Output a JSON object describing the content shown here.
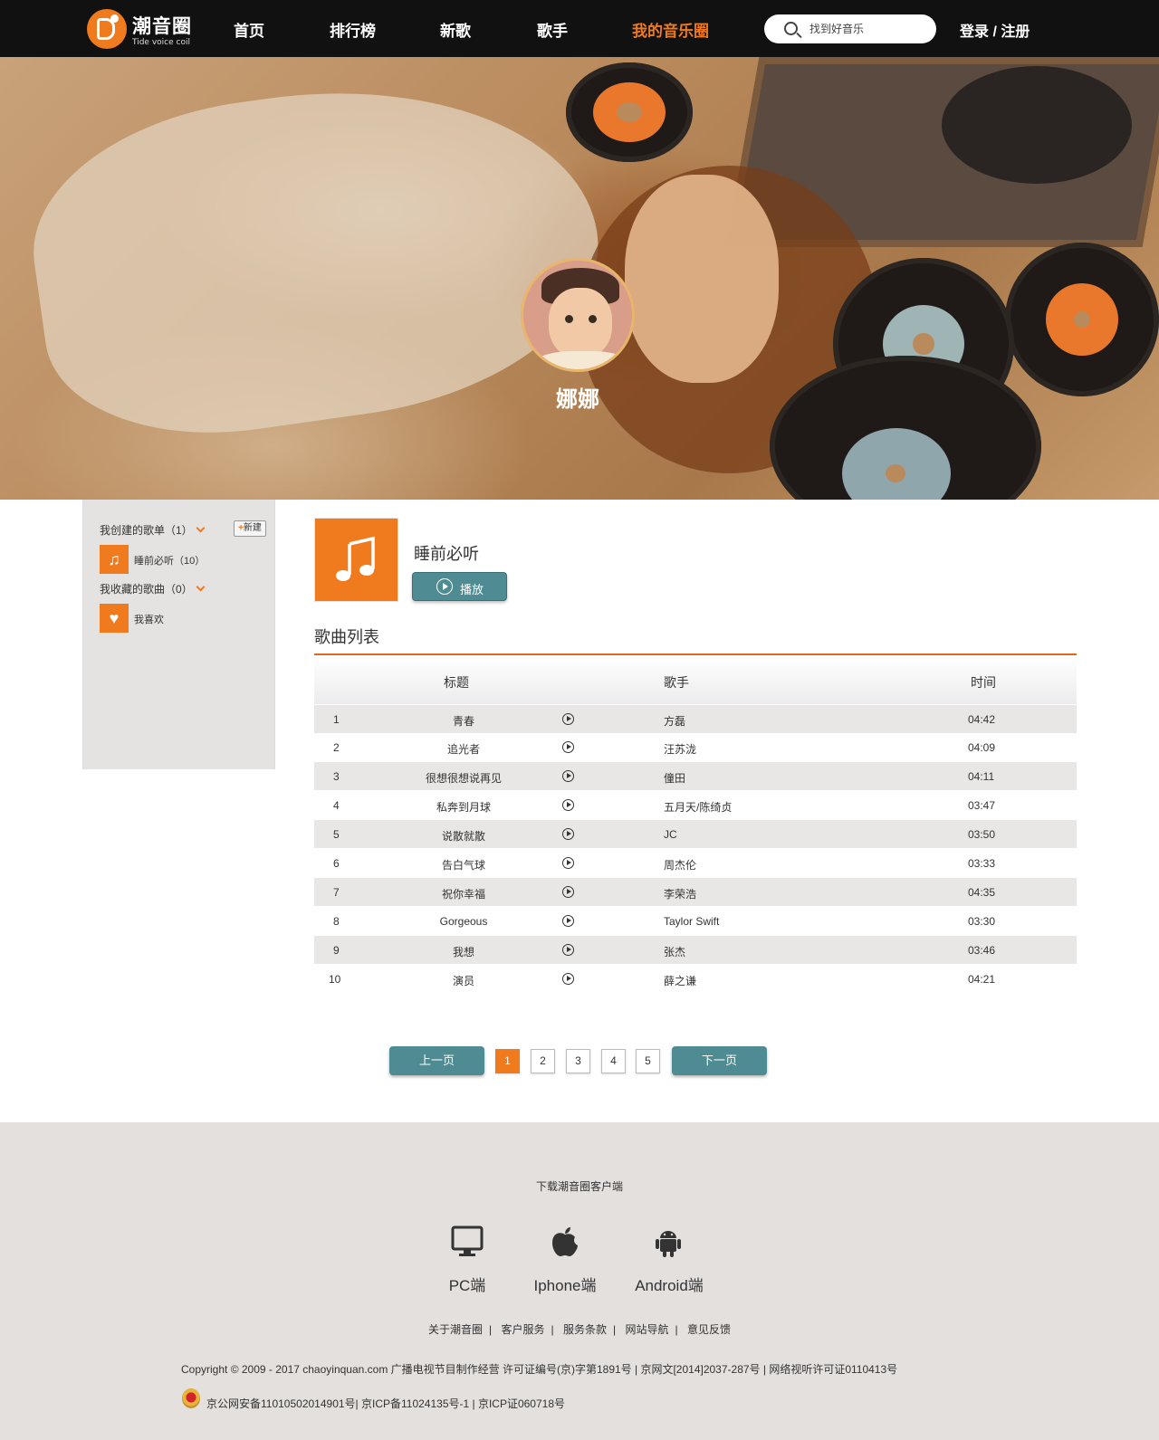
{
  "header": {
    "logo_text": "潮音圈",
    "logo_sub": "Tide voice coil",
    "nav": [
      "首页",
      "排行榜",
      "新歌",
      "歌手",
      "我的音乐圈"
    ],
    "search_placeholder": "找到好音乐",
    "login": "登录 / 注册",
    "accent_color": "#f07a1e"
  },
  "profile": {
    "username": "娜娜"
  },
  "sidebar": {
    "created_label": "我创建的歌单（1）",
    "new_label": "新建",
    "created_items": [
      {
        "label": "睡前必听（10）",
        "icon": "music-note-icon"
      }
    ],
    "collected_label": "我收藏的歌曲（0）",
    "collected_items": [
      {
        "label": "我喜欢",
        "icon": "heart-icon"
      }
    ]
  },
  "playlist": {
    "title": "睡前必听",
    "play_label": "播放",
    "section_title": "歌曲列表",
    "columns": {
      "title": "标题",
      "artist": "歌手",
      "time": "时间"
    },
    "songs": [
      {
        "no": "1",
        "title": "青春",
        "artist": "方磊",
        "time": "04:42"
      },
      {
        "no": "2",
        "title": "追光者",
        "artist": "汪苏泷",
        "time": "04:09"
      },
      {
        "no": "3",
        "title": "很想很想说再见",
        "artist": "僮田",
        "time": "04:11"
      },
      {
        "no": "4",
        "title": "私奔到月球",
        "artist": "五月天/陈绮贞",
        "time": "03:47"
      },
      {
        "no": "5",
        "title": "说散就散",
        "artist": "JC",
        "time": "03:50"
      },
      {
        "no": "6",
        "title": "告白气球",
        "artist": "周杰伦",
        "time": "03:33"
      },
      {
        "no": "7",
        "title": "祝你幸福",
        "artist": "李荣浩",
        "time": "04:35"
      },
      {
        "no": "8",
        "title": "Gorgeous",
        "artist": "Taylor Swift",
        "time": "03:30"
      },
      {
        "no": "9",
        "title": "我想",
        "artist": "张杰",
        "time": "03:46"
      },
      {
        "no": "10",
        "title": "演员",
        "artist": "薛之谦",
        "time": "04:21"
      }
    ]
  },
  "pagination": {
    "prev": "上一页",
    "next": "下一页",
    "pages": [
      "1",
      "2",
      "3",
      "4",
      "5"
    ],
    "current": "1",
    "button_color": "#4e8b93"
  },
  "footer": {
    "download_label": "下载潮音圈客户端",
    "clients": [
      {
        "label": "PC端",
        "icon": "monitor-icon"
      },
      {
        "label": "Iphone端",
        "icon": "apple-icon"
      },
      {
        "label": "Android端",
        "icon": "android-icon"
      }
    ],
    "links": [
      "关于潮音圈",
      "客户服务",
      "服务条款",
      "网站导航",
      "意见反馈"
    ],
    "copyright": "Copyright © 2009 - 2017 chaoyinquan.com 广播电视节目制作经营 许可证编号(京)字第1891号 | 京网文[2014]2037-287号 | 网络视听许可证0110413号",
    "icp": "京公网安备11010502014901号| 京ICP备11024135号-1 | 京ICP证060718号"
  }
}
